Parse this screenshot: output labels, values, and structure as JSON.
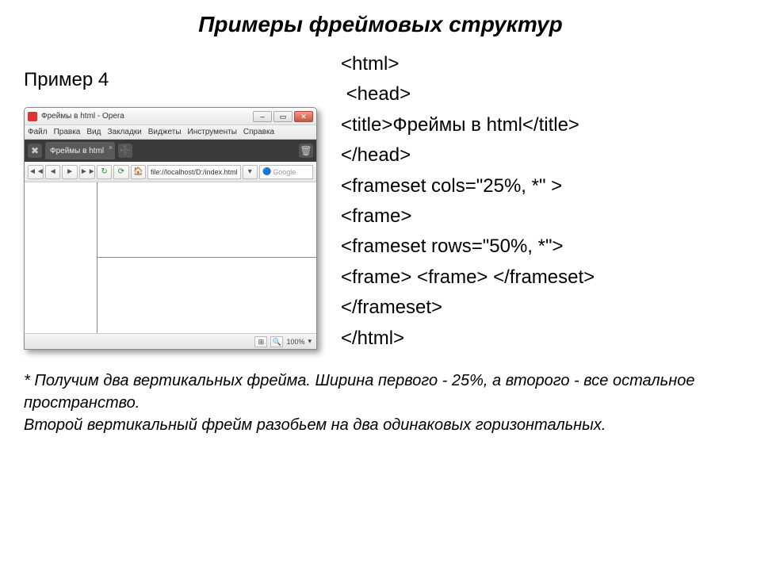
{
  "page_title": "Примеры фреймовых структур",
  "example_label": "Пример 4",
  "browser": {
    "title": "Фреймы в html - Opera",
    "menu": {
      "file": "Файл",
      "edit": "Правка",
      "view": "Вид",
      "bookmarks": "Закладки",
      "widgets": "Виджеты",
      "tools": "Инструменты",
      "help": "Справка"
    },
    "tab_label": "Фреймы в html",
    "url": "file://localhost/D:/index.html",
    "search_placeholder": "Google",
    "zoom": "100%",
    "winbtn_min": "–",
    "winbtn_max": "▭",
    "winbtn_close": "✕",
    "nav": {
      "back": "◄",
      "fwd": "►",
      "rewind": "◄◄",
      "ffwd": "►►",
      "reload": "↻",
      "stop": "⟳",
      "home": "▾"
    },
    "status_view": "⊞",
    "status_zoom": "🔍"
  },
  "code": {
    "l1": "<html>",
    "l2": " <head>",
    "l3": "<title>Фреймы в html</title>",
    "l4": "</head>",
    "l5": "<frameset cols=\"25%, *\" >",
    "l6": "<frame>",
    "l7": "<frameset rows=\"50%, *\">",
    "l8": "<frame> <frame> </frameset>",
    "l9": "</frameset>",
    "l10": "</html>"
  },
  "footer": {
    "p1": "* Получим два вертикальных фрейма. Ширина первого - 25%, а второго - все остальное пространство.",
    "p2": "Второй вертикальный фрейм разобьем на два одинаковых горизонтальных."
  }
}
